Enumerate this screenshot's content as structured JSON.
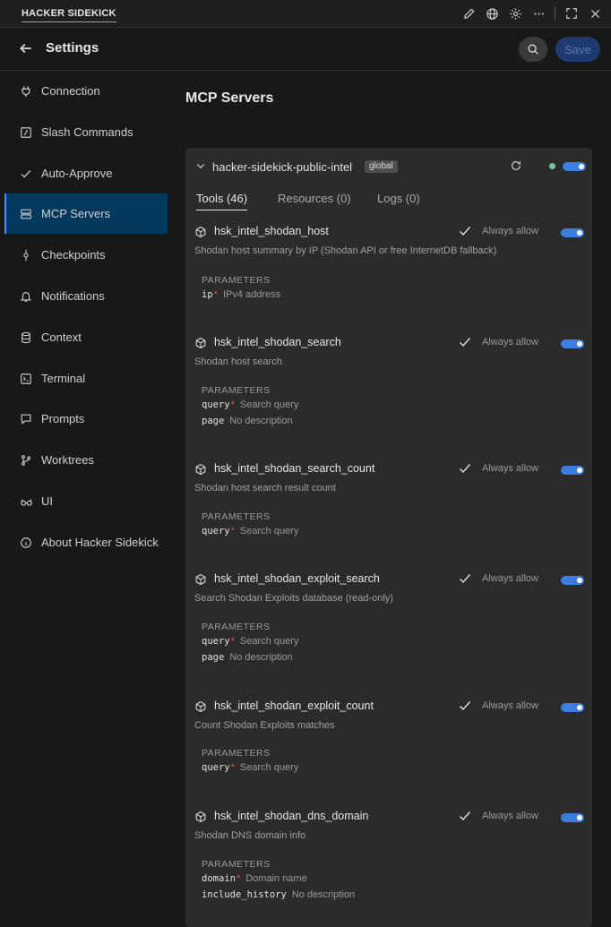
{
  "titlebar": {
    "brand": "HACKER SIDEKICK"
  },
  "header": {
    "title": "Settings",
    "save_label": "Save"
  },
  "sidebar": {
    "items": [
      {
        "label": "Connection",
        "icon": "plug-icon"
      },
      {
        "label": "Slash Commands",
        "icon": "slash-icon"
      },
      {
        "label": "Auto-Approve",
        "icon": "check-icon"
      },
      {
        "label": "MCP Servers",
        "icon": "server-icon",
        "active": true
      },
      {
        "label": "Checkpoints",
        "icon": "commit-icon"
      },
      {
        "label": "Notifications",
        "icon": "bell-icon"
      },
      {
        "label": "Context",
        "icon": "database-icon"
      },
      {
        "label": "Terminal",
        "icon": "terminal-icon"
      },
      {
        "label": "Prompts",
        "icon": "chat-icon"
      },
      {
        "label": "Worktrees",
        "icon": "branch-icon"
      },
      {
        "label": "UI",
        "icon": "glasses-icon"
      },
      {
        "label": "About Hacker Sidekick",
        "icon": "info-icon"
      }
    ]
  },
  "main": {
    "title": "MCP Servers",
    "server": {
      "name": "hacker-sidekick-public-intel",
      "badge": "global",
      "status_color": "#73c991",
      "enabled": true,
      "tabs": [
        {
          "label": "Tools (46)",
          "active": true
        },
        {
          "label": "Resources (0)"
        },
        {
          "label": "Logs (0)"
        }
      ],
      "always_allow_label": "Always allow",
      "params_label": "PARAMETERS",
      "tools": [
        {
          "name": "hsk_intel_shodan_host",
          "description": "Shodan host summary by IP (Shodan API or free InternetDB fallback)",
          "always_allow": true,
          "enabled": true,
          "params": [
            {
              "name": "ip",
              "required": true,
              "desc": "IPv4 address"
            }
          ]
        },
        {
          "name": "hsk_intel_shodan_search",
          "description": "Shodan host search",
          "always_allow": true,
          "enabled": true,
          "params": [
            {
              "name": "query",
              "required": true,
              "desc": "Search query"
            },
            {
              "name": "page",
              "required": false,
              "desc": "No description"
            }
          ]
        },
        {
          "name": "hsk_intel_shodan_search_count",
          "description": "Shodan host search result count",
          "always_allow": true,
          "enabled": true,
          "params": [
            {
              "name": "query",
              "required": true,
              "desc": "Search query"
            }
          ]
        },
        {
          "name": "hsk_intel_shodan_exploit_search",
          "description": "Search Shodan Exploits database (read-only)",
          "always_allow": true,
          "enabled": true,
          "params": [
            {
              "name": "query",
              "required": true,
              "desc": "Search query"
            },
            {
              "name": "page",
              "required": false,
              "desc": "No description"
            }
          ]
        },
        {
          "name": "hsk_intel_shodan_exploit_count",
          "description": "Count Shodan Exploits matches",
          "always_allow": true,
          "enabled": true,
          "params": [
            {
              "name": "query",
              "required": true,
              "desc": "Search query"
            }
          ]
        },
        {
          "name": "hsk_intel_shodan_dns_domain",
          "description": "Shodan DNS domain info",
          "always_allow": true,
          "enabled": true,
          "params": [
            {
              "name": "domain",
              "required": true,
              "desc": "Domain name"
            },
            {
              "name": "include_history",
              "required": false,
              "desc": "No description"
            }
          ]
        }
      ]
    }
  },
  "colors": {
    "accent": "#3c7de0",
    "active_nav": "#04395e",
    "required": "#f14c4c"
  }
}
